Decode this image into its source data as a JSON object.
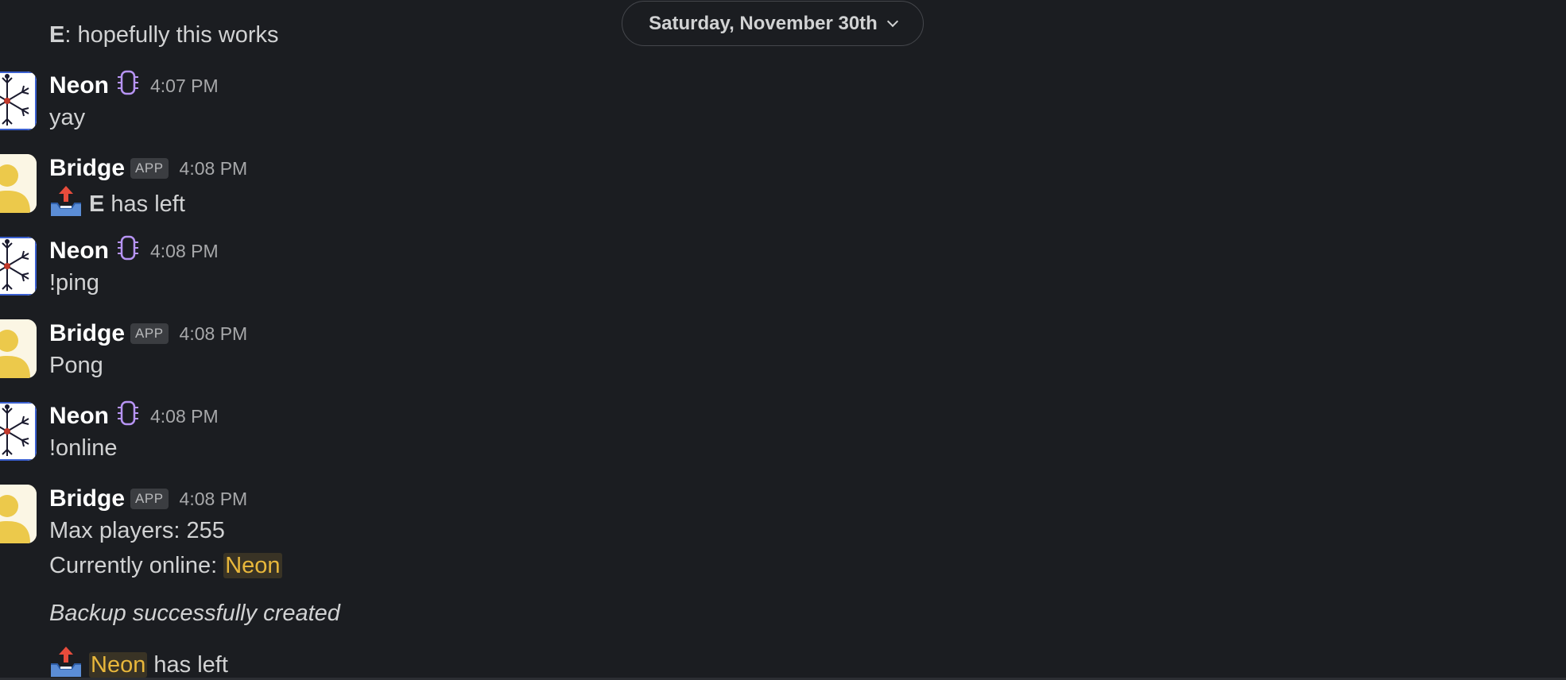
{
  "date_divider": {
    "label": "Saturday, November 30th"
  },
  "first_line": {
    "sender": "E",
    "text": ": hopefully this works"
  },
  "messages": [
    {
      "author": "Neon",
      "time": "4:07 PM",
      "line1": "yay"
    },
    {
      "author": "Bridge",
      "badge": "APP",
      "time": "4:08 PM",
      "bold": "E",
      "line1": " has left"
    },
    {
      "author": "Neon",
      "time": "4:08 PM",
      "line1": "!ping"
    },
    {
      "author": "Bridge",
      "badge": "APP",
      "time": "4:08 PM",
      "line1": "Pong"
    },
    {
      "author": "Neon",
      "time": "4:08 PM",
      "line1": "!online"
    },
    {
      "author": "Bridge",
      "badge": "APP",
      "time": "4:08 PM",
      "line1": "Max players: 255",
      "line2_prefix": "Currently online: ",
      "line2_mention": "Neon",
      "line3": "Backup successfully created",
      "line4_mention": "Neon",
      "line4_suffix": " has left"
    }
  ],
  "colors": {
    "background": "#1b1d21",
    "mention": "#e8b73b",
    "chip": "#b794f4"
  }
}
